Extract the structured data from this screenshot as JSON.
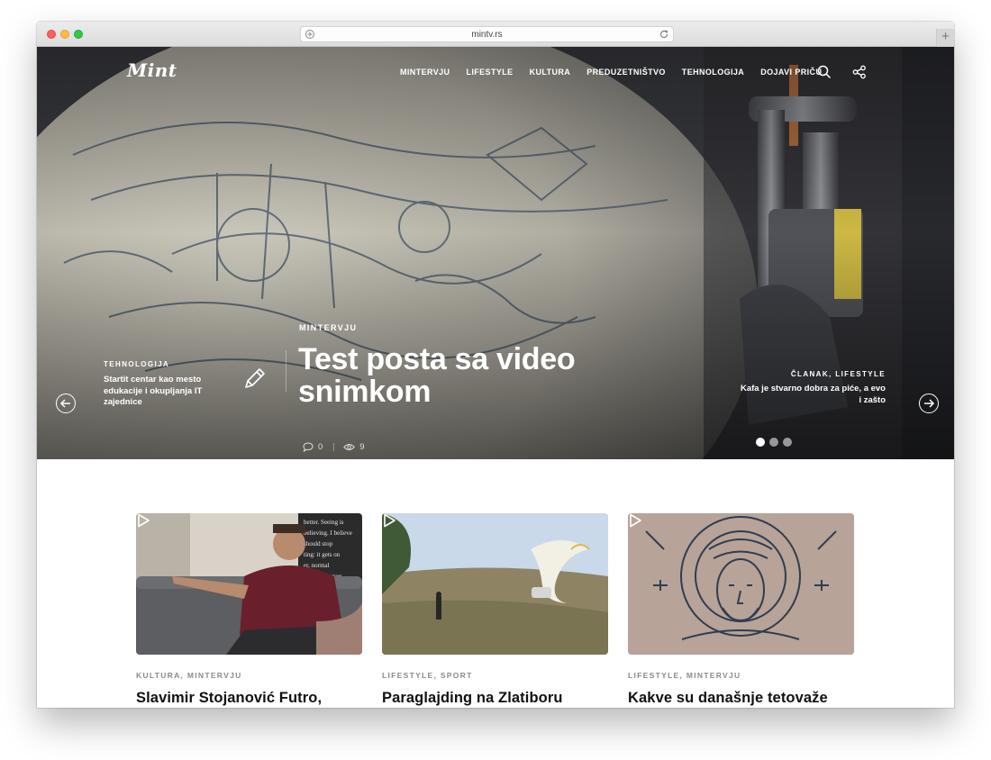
{
  "browser": {
    "url": "mintv.rs",
    "new_tab_label": "+"
  },
  "site": {
    "logo": "Mint",
    "menu": [
      "MINTERVJU",
      "LIFESTYLE",
      "KULTURA",
      "PREDUZETNIŠTVO",
      "TEHNOLOGIJA",
      "DOJAVI PRIČU"
    ],
    "icons": {
      "search": "search-icon",
      "share": "share-icon"
    }
  },
  "hero": {
    "left_teaser": {
      "category": "TEHNOLOGIJA",
      "title": "Startit centar kao mesto edukacije i okupljanja IT zajednice"
    },
    "main": {
      "category": "MINTERVJU",
      "title": "Test posta sa video snimkom",
      "comments": "0",
      "views": "9"
    },
    "right_teaser": {
      "category": "ČLANAK, LIFESTYLE",
      "title": "Kafa je stvarno dobra za piće, a evo i zašto"
    },
    "slides_count": 3,
    "active_slide": 1
  },
  "cards": [
    {
      "categories": "KULTURA, MINTERVJU",
      "title": "Slavimir Stojanović Futro,"
    },
    {
      "categories": "LIFESTYLE, SPORT",
      "title": "Paraglajding na Zlatiboru"
    },
    {
      "categories": "LIFESTYLE, MINTERVJU",
      "title": "Kakve su današnje tetovaže"
    }
  ]
}
